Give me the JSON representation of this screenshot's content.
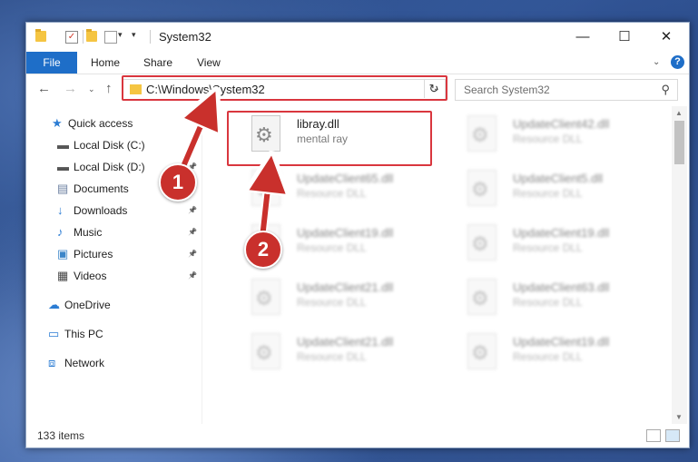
{
  "window": {
    "title": "System32",
    "controls": {
      "minimize": "—",
      "maximize": "☐",
      "close": "✕"
    }
  },
  "ribbon": {
    "tabs": [
      "File",
      "Home",
      "Share",
      "View"
    ],
    "help": "?"
  },
  "nav": {
    "address": "C:\\Windows\\System32",
    "search_placeholder": "Search System32"
  },
  "sidebar": {
    "items": [
      {
        "label": "Quick access",
        "icon": "star-icon",
        "pinned": false
      },
      {
        "label": "Local Disk (C:)",
        "icon": "drive-icon",
        "pinned": true
      },
      {
        "label": "Local Disk (D:)",
        "icon": "drive-icon",
        "pinned": true
      },
      {
        "label": "Documents",
        "icon": "document-icon",
        "pinned": true
      },
      {
        "label": "Downloads",
        "icon": "download-icon",
        "pinned": true
      },
      {
        "label": "Music",
        "icon": "music-icon",
        "pinned": true
      },
      {
        "label": "Pictures",
        "icon": "pictures-icon",
        "pinned": true
      },
      {
        "label": "Videos",
        "icon": "video-icon",
        "pinned": true
      },
      {
        "label": "OneDrive",
        "icon": "cloud-icon",
        "pinned": false
      },
      {
        "label": "This PC",
        "icon": "computer-icon",
        "pinned": false,
        "selected": true
      },
      {
        "label": "Network",
        "icon": "network-icon",
        "pinned": false
      }
    ]
  },
  "files": {
    "featured": {
      "name": "libray.dll",
      "type": "mental ray"
    },
    "others": [
      {
        "name": "UpdateClient42.dll",
        "type": "Resource DLL"
      },
      {
        "name": "UpdateClient65.dll",
        "type": "Resource DLL"
      },
      {
        "name": "UpdateClient5.dll",
        "type": "Resource DLL"
      },
      {
        "name": "UpdateClient19.dll",
        "type": "Resource DLL"
      },
      {
        "name": "UpdateClient19.dll",
        "type": "Resource DLL"
      },
      {
        "name": "UpdateClient21.dll",
        "type": "Resource DLL"
      },
      {
        "name": "UpdateClient63.dll",
        "type": "Resource DLL"
      },
      {
        "name": "UpdateClient21.dll",
        "type": "Resource DLL"
      },
      {
        "name": "UpdateClient19.dll",
        "type": "Resource DLL"
      }
    ]
  },
  "status": {
    "item_count": "133 items"
  },
  "callouts": [
    "1",
    "2"
  ],
  "colors": {
    "accent": "#1e6ec8",
    "callout": "#c9302c",
    "selection": "#cce4f7"
  }
}
